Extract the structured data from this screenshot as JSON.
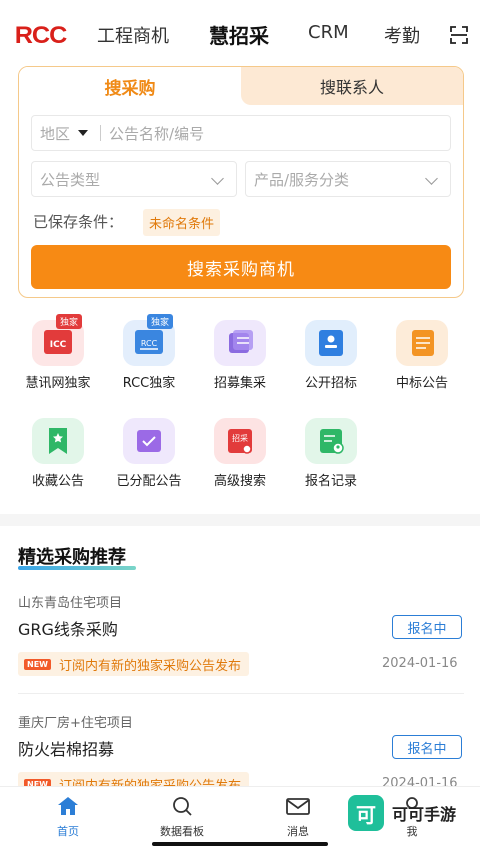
{
  "brand": {
    "logo_text": "RCC",
    "logo_color": "#d9201a"
  },
  "nav": {
    "tabs": [
      {
        "label": "工程商机"
      },
      {
        "label": "慧招采"
      },
      {
        "label": "CRM"
      },
      {
        "label": "考勤"
      }
    ],
    "active_tab": "慧招采"
  },
  "search_card": {
    "tabs": [
      {
        "label": "搜采购"
      },
      {
        "label": "搜联系人"
      }
    ],
    "region_label": "地区",
    "keyword_placeholder": "公告名称/编号",
    "type_placeholder": "公告类型",
    "category_placeholder": "产品/服务分类",
    "saved_label": "已保存条件：",
    "saved_tag": "未命名条件",
    "search_button": "搜索采购商机"
  },
  "grid": [
    {
      "label": "慧讯网独家",
      "icon": "icc-exclusive-icon",
      "badge": "独家"
    },
    {
      "label": "RCC独家",
      "icon": "rcc-exclusive-icon",
      "badge": "独家"
    },
    {
      "label": "招募集采",
      "icon": "centralized-purchase-icon"
    },
    {
      "label": "公开招标",
      "icon": "public-tender-icon"
    },
    {
      "label": "中标公告",
      "icon": "winning-bid-icon"
    },
    {
      "label": "收藏公告",
      "icon": "bookmark-icon"
    },
    {
      "label": "已分配公告",
      "icon": "assigned-icon"
    },
    {
      "label": "高级搜索",
      "icon": "advanced-search-icon",
      "icon_text": "招采"
    },
    {
      "label": "报名记录",
      "icon": "registration-record-icon"
    }
  ],
  "recommend": {
    "title": "精选采购推荐",
    "items": [
      {
        "area": "山东青岛住宅项目",
        "title": "GRG线条采购",
        "status": "报名中",
        "new_tag": "NEW",
        "notice": "订阅内有新的独家采购公告发布",
        "date": "2024-01-16"
      },
      {
        "area": "重庆厂房+住宅项目",
        "title": "防火岩棉招募",
        "status": "报名中",
        "new_tag": "NEW",
        "notice": "订阅内有新的独家采购公告发布",
        "date": "2024-01-16"
      }
    ]
  },
  "bottom_nav": [
    {
      "label": "首页",
      "icon": "home-icon"
    },
    {
      "label": "数据看板",
      "icon": "search-icon"
    },
    {
      "label": "消息",
      "icon": "mail-icon"
    },
    {
      "label": "我",
      "icon": "profile-icon"
    }
  ],
  "watermark": {
    "glyph": "可",
    "text": "可可手游"
  },
  "colors": {
    "accent": "#f78a14",
    "link": "#2c7ed6",
    "brand_red": "#d9201a"
  }
}
